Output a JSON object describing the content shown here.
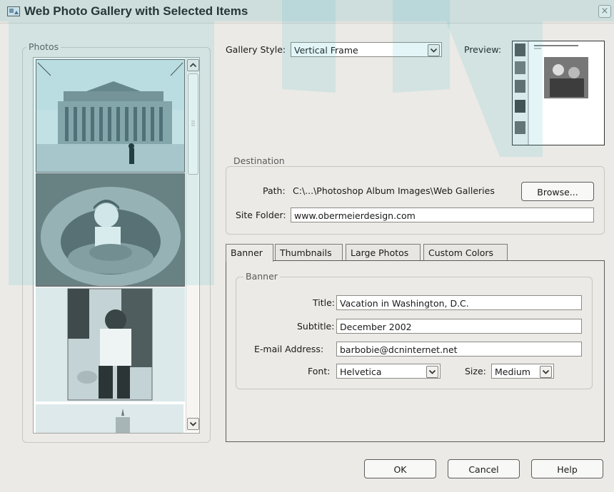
{
  "window": {
    "title": "Web Photo Gallery with Selected Items",
    "close_glyph": "×"
  },
  "photos": {
    "legend": "Photos",
    "items": [
      "photo-1",
      "photo-2",
      "photo-3",
      "photo-4"
    ]
  },
  "gallery": {
    "style_label": "Gallery Style:",
    "style_value": "Vertical Frame",
    "preview_label": "Preview:"
  },
  "destination": {
    "legend": "Destination",
    "path_label": "Path:",
    "path_value": "C:\\...\\Photoshop Album Images\\Web Galleries",
    "browse_label": "Browse...",
    "site_label": "Site Folder:",
    "site_value": "www.obermeierdesign.com"
  },
  "tabs": [
    "Banner",
    "Thumbnails",
    "Large Photos",
    "Custom Colors"
  ],
  "banner": {
    "legend": "Banner",
    "title_label": "Title:",
    "title_value": "Vacation in Washington, D.C.",
    "subtitle_label": "Subtitle:",
    "subtitle_value": "December 2002",
    "email_label": "E-mail Address:",
    "email_value": "barbobie@dcninternet.net",
    "font_label": "Font:",
    "font_value": "Helvetica",
    "size_label": "Size:",
    "size_value": "Medium"
  },
  "buttons": {
    "ok": "OK",
    "cancel": "Cancel",
    "help": "Help"
  },
  "colors": {
    "watermark": "#3fb9c5",
    "border": "#5a5a5a"
  }
}
